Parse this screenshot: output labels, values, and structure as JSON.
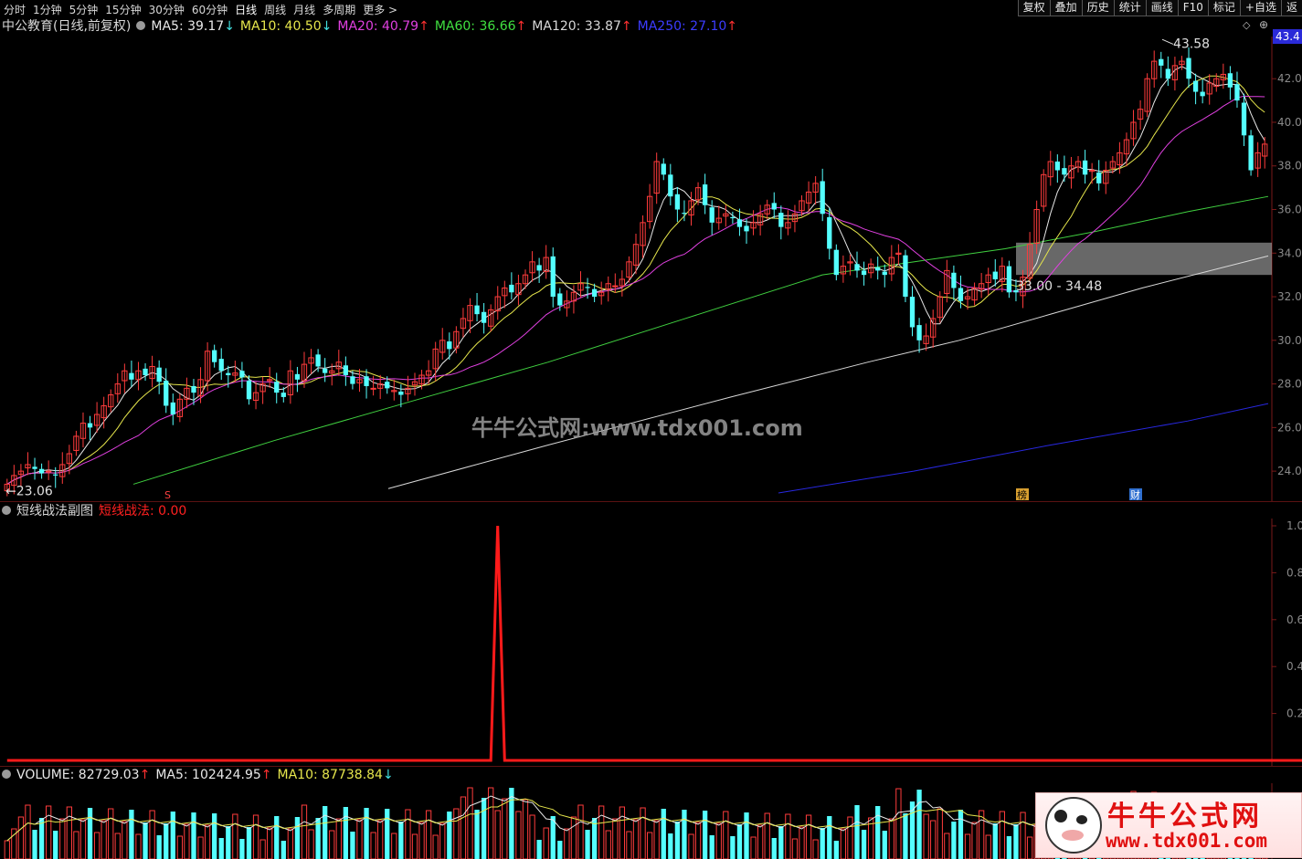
{
  "toolbar": {
    "periods": [
      "分时",
      "1分钟",
      "5分钟",
      "15分钟",
      "30分钟",
      "60分钟",
      "日线",
      "周线",
      "月线",
      "多周期",
      "更多 >"
    ],
    "active_period": "日线",
    "right_buttons": [
      "复权",
      "叠加",
      "历史",
      "统计",
      "画线",
      "F10",
      "标记",
      "+自选",
      "返"
    ]
  },
  "main_header": {
    "title": "中公教育(日线,前复权)",
    "indicators": [
      {
        "label": "MA5: 39.17",
        "arrow": "↓",
        "color": "#e8e8e8"
      },
      {
        "label": "MA10: 40.50",
        "arrow": "↓",
        "color": "#e6e64c"
      },
      {
        "label": "MA20: 40.79",
        "arrow": "↑",
        "color": "#e040e0"
      },
      {
        "label": "MA60: 36.66",
        "arrow": "↑",
        "color": "#40e040"
      },
      {
        "label": "MA120: 33.87",
        "arrow": "↑",
        "color": "#d8d8d8"
      },
      {
        "label": "MA250: 27.10",
        "arrow": "↑",
        "color": "#3c3cff"
      }
    ]
  },
  "price_axis": {
    "top_badge": "43.4",
    "ticks": [
      "42.0",
      "40.0",
      "38.0",
      "36.0",
      "34.0",
      "32.0",
      "30.0",
      "28.0",
      "26.0",
      "24.0"
    ]
  },
  "annotations": {
    "high": "43.58",
    "low": "23.06",
    "zone": "33.00 - 34.48",
    "watermark": "牛牛公式网:www.tdx001.com",
    "marker_s": "S",
    "marker_bang": "榜",
    "marker_cai": "财"
  },
  "sub_chart": {
    "title": "短线战法副图",
    "indicator": "短线战法: 0.00",
    "indicator_color": "#ff2020",
    "ticks": [
      "1.0",
      "0.8",
      "0.6",
      "0.4",
      "0.2"
    ],
    "signal_values": [
      0,
      0,
      0,
      0,
      0,
      0,
      0,
      0,
      0,
      0,
      0,
      0,
      0,
      0,
      0,
      0,
      0,
      0,
      0,
      0,
      0,
      0,
      0,
      0,
      0,
      0,
      0,
      0,
      0,
      0,
      0,
      0,
      0,
      0,
      0,
      0,
      0,
      0,
      0,
      0,
      0,
      0,
      0,
      0,
      0,
      0,
      0,
      0,
      0,
      0,
      0,
      0,
      0,
      0,
      0,
      0,
      0,
      0,
      0,
      0,
      0,
      0,
      0,
      0,
      0,
      0,
      0,
      0,
      0,
      0,
      0,
      0,
      0,
      0,
      0,
      0,
      0,
      0,
      0,
      0,
      0,
      0,
      0,
      0,
      0,
      0,
      0,
      0,
      0,
      0,
      0,
      0,
      0,
      0,
      0,
      0,
      0,
      0,
      0,
      0,
      0,
      0,
      0,
      0,
      0,
      0,
      0,
      0,
      0,
      0,
      0,
      0,
      0,
      0,
      0,
      0,
      0,
      0,
      0,
      0,
      0,
      0,
      0,
      0,
      0,
      0,
      0,
      0,
      0,
      0,
      0,
      0,
      0,
      0,
      0,
      0,
      0,
      0,
      0,
      0,
      0,
      0,
      0,
      0,
      0,
      0,
      0,
      0,
      0,
      0,
      0,
      0,
      0,
      0,
      0,
      0,
      0,
      0,
      0,
      0,
      0,
      0,
      0,
      0,
      0,
      0,
      0,
      0,
      0,
      0,
      0,
      0,
      0,
      0,
      0,
      0,
      0,
      0,
      0,
      0,
      0,
      0,
      0,
      0,
      0,
      0,
      0,
      0,
      0,
      0,
      0,
      0,
      0
    ],
    "signal_peak_index": 71
  },
  "volume_header": {
    "items": [
      {
        "label": "VOLUME: 82729.03",
        "arrow": "↑",
        "color": "#e8e8e8"
      },
      {
        "label": "MA5: 102424.95",
        "arrow": "↑",
        "color": "#e8e8e8"
      },
      {
        "label": "MA10: 87738.84",
        "arrow": "↓",
        "color": "#e6e64c"
      }
    ]
  },
  "logo": {
    "line1": "牛牛公式网",
    "line2": "www.tdx001.com"
  },
  "chart_data": {
    "type": "candlestick",
    "ylim": [
      23.0,
      43.6
    ],
    "closes": [
      23.4,
      23.8,
      24.0,
      24.3,
      24.1,
      23.9,
      24.0,
      23.8,
      24.3,
      24.8,
      25.6,
      26.2,
      26.0,
      26.6,
      27.0,
      27.5,
      28.0,
      28.6,
      28.2,
      28.6,
      28.4,
      28.8,
      28.1,
      27.0,
      26.6,
      27.3,
      27.8,
      27.6,
      28.2,
      29.5,
      29.0,
      28.6,
      28.4,
      28.5,
      28.3,
      27.3,
      27.6,
      28.0,
      28.2,
      27.6,
      27.4,
      28.6,
      28.2,
      28.9,
      29.2,
      28.8,
      28.5,
      28.6,
      29.0,
      28.4,
      28.0,
      28.2,
      27.9,
      27.8,
      28.0,
      27.8,
      27.7,
      27.5,
      27.8,
      28.1,
      28.4,
      28.6,
      29.6,
      30.0,
      29.6,
      30.4,
      31.0,
      31.6,
      31.2,
      30.8,
      31.4,
      32.0,
      32.4,
      32.2,
      32.6,
      33.0,
      33.6,
      33.2,
      33.8,
      32.0,
      31.6,
      31.8,
      32.2,
      32.6,
      32.4,
      32.0,
      32.2,
      32.6,
      32.5,
      32.8,
      33.6,
      34.4,
      35.4,
      36.6,
      38.2,
      37.6,
      36.6,
      36.0,
      35.8,
      36.4,
      37.0,
      36.2,
      35.4,
      35.6,
      35.8,
      35.6,
      35.2,
      35.0,
      35.4,
      35.8,
      36.2,
      36.0,
      35.2,
      35.4,
      35.8,
      36.4,
      36.8,
      37.2,
      35.8,
      34.2,
      33.0,
      33.4,
      33.6,
      33.2,
      33.0,
      33.5,
      33.2,
      33.0,
      33.8,
      34.0,
      32.0,
      30.6,
      30.0,
      30.2,
      31.0,
      32.0,
      33.2,
      32.4,
      31.8,
      32.0,
      32.4,
      32.6,
      33.0,
      32.8,
      33.4,
      32.2,
      32.2,
      32.9,
      34.4,
      36.0,
      37.6,
      38.2,
      37.8,
      37.6,
      38.0,
      38.2,
      37.6,
      37.8,
      37.2,
      37.8,
      38.2,
      38.6,
      39.2,
      40.0,
      40.6,
      42.0,
      42.8,
      42.6,
      42.0,
      42.6,
      42.8,
      42.0,
      41.4,
      41.2,
      41.8,
      42.0,
      42.2,
      41.6,
      41.0,
      39.4,
      37.8,
      38.6,
      39.0
    ]
  }
}
